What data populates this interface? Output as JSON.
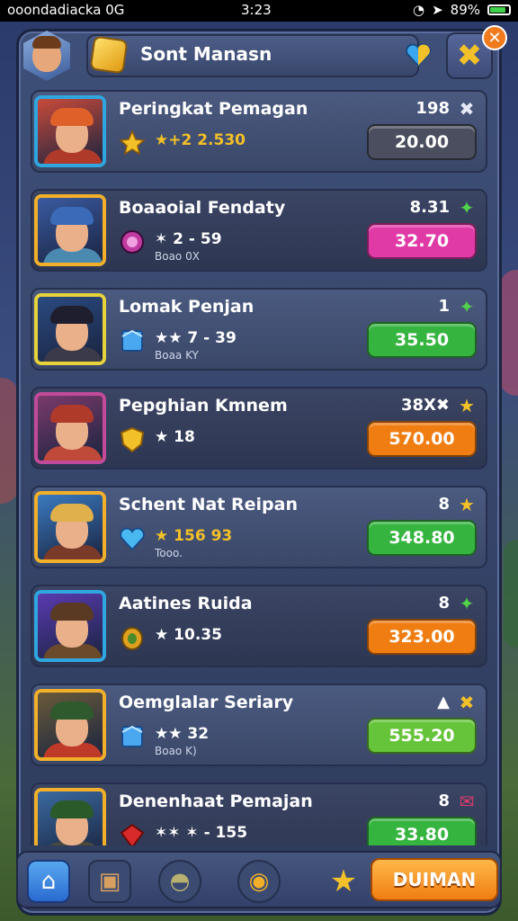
{
  "status_bar": {
    "carrier": "ooondadiacka  0G",
    "time": "3:23",
    "battery": "89%"
  },
  "header": {
    "title": "Sont Manasn"
  },
  "colors": {
    "accent_orange": "#f7841c",
    "accent_green": "#3dbf3d",
    "accent_pink": "#e03aa6",
    "panel": "#3a4768"
  },
  "players": [
    {
      "name": "Peringkat Pemagan",
      "stat": "★+2 2.530",
      "sub": "",
      "rank": "198",
      "badge": "✖",
      "badge_color": "#e6e9f5",
      "value": "20.00",
      "button_color": "#4a4e5e",
      "frame_color": "#2fa6e0",
      "icon": "star-icon",
      "theme": "red-hair"
    },
    {
      "name": "Boaaoial Fendaty",
      "stat": "✶ 2 - 59",
      "sub": "Boao 0X",
      "rank": "8.31",
      "badge": "✦",
      "badge_color": "#52d24a",
      "value": "32.70",
      "button_color": "#e03aa6",
      "frame_color": "#f2b02a",
      "icon": "potion-icon",
      "theme": "blue-cap"
    },
    {
      "name": "Lomak Penjan",
      "stat": "★★ 7 - 39",
      "sub": "Boaa KY",
      "rank": "1",
      "badge": "✦",
      "badge_color": "#52d24a",
      "value": "35.50",
      "button_color": "#36b440",
      "frame_color": "#e6d23a",
      "icon": "cube-icon",
      "theme": "dark-hat"
    },
    {
      "name": "Pepghian Kmnem",
      "stat": "★ 18",
      "sub": "",
      "rank": "38X✖",
      "badge": "★",
      "badge_color": "#f2c028",
      "value": "570.00",
      "button_color": "#f07d12",
      "frame_color": "#c24a9a",
      "icon": "shield-icon",
      "theme": "red-bandana"
    },
    {
      "name": "Schent Nat Reipan",
      "stat": "★ 156 93",
      "sub": "Tooo.",
      "rank": "8",
      "badge": "★",
      "badge_color": "#f2c028",
      "value": "348.80",
      "button_color": "#36b440",
      "frame_color": "#f2b02a",
      "icon": "heart-icon",
      "theme": "blond"
    },
    {
      "name": "Aatines Ruida",
      "stat": "★ 10.35",
      "sub": "",
      "rank": "8",
      "badge": "✦",
      "badge_color": "#52d24a",
      "value": "323.00",
      "button_color": "#f07d12",
      "frame_color": "#2fa6e0",
      "icon": "gem-icon",
      "theme": "brown-hat"
    },
    {
      "name": "Oemglalar Seriary",
      "stat": "★★ 32",
      "sub": "Boao K)",
      "rank": "▲",
      "badge": "✖",
      "badge_color": "#f2c028",
      "value": "555.20",
      "button_color": "#66c43a",
      "frame_color": "#f2b02a",
      "icon": "cube-icon",
      "theme": "green-cap"
    },
    {
      "name": "Denenhaat Pemajan",
      "stat": "✶✶ ✶ - 155",
      "sub": "",
      "rank": "8",
      "badge": "✉",
      "badge_color": "#e03a6a",
      "value": "33.80",
      "button_color": "#36b440",
      "frame_color": "#f2b02a",
      "icon": "ruby-icon",
      "theme": "green-hat"
    }
  ],
  "bottom_bar": {
    "cta_label": "DUIMAN"
  }
}
